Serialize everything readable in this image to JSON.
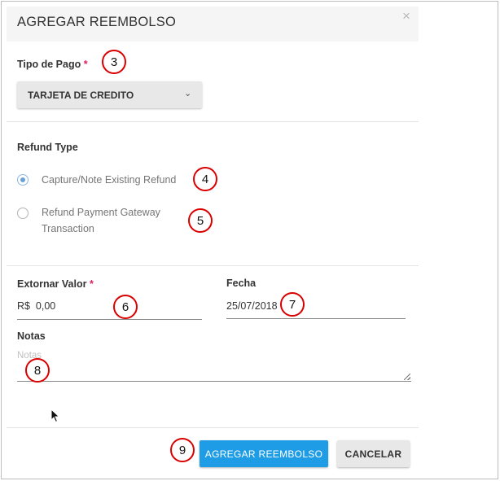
{
  "dialog": {
    "title": "AGREGAR REEMBOLSO",
    "close_symbol": "×"
  },
  "payment_type": {
    "label": "Tipo de Pago",
    "required_mark": "*",
    "selected_value": "TARJETA DE CREDITO",
    "chevron_symbol": "⌄"
  },
  "refund_type": {
    "label": "Refund Type",
    "options": [
      {
        "label": "Capture/Note Existing Refund",
        "checked": true
      },
      {
        "label_line1": "Refund Payment Gateway",
        "label_line2": "Transaction",
        "checked": false
      }
    ]
  },
  "amount": {
    "label": "Extornar Valor",
    "required_mark": "*",
    "value": "R$  0,00"
  },
  "date": {
    "label": "Fecha",
    "value": "25/07/2018"
  },
  "notes": {
    "label": "Notas",
    "placeholder": "Notas"
  },
  "actions": {
    "submit_label": "AGREGAR REEMBOLSO",
    "cancel_label": "CANCELAR"
  },
  "markers": [
    "3",
    "4",
    "5",
    "6",
    "7",
    "8",
    "9"
  ],
  "colors": {
    "primary": "#1e9ce6",
    "required": "#e0205a",
    "marker_ring": "#d90000",
    "radio_checked": "#6aa2d8"
  }
}
